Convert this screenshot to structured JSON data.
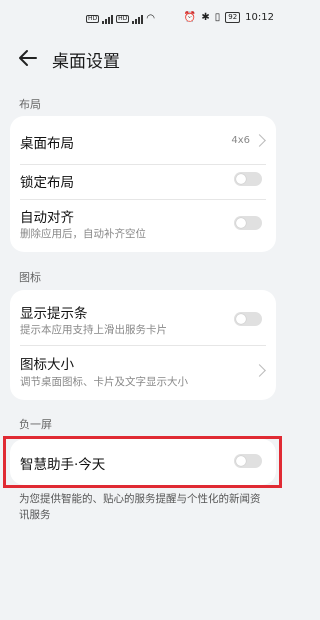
{
  "status": {
    "network_badges": [
      "HD",
      "HD"
    ],
    "battery": "92",
    "time": "10:12",
    "icons": [
      "signal-icon",
      "wifi-icon",
      "alarm-icon",
      "bluetooth-icon",
      "vibrate-icon",
      "battery-icon"
    ]
  },
  "header": {
    "title": "桌面设置",
    "back_icon": "back-arrow-icon"
  },
  "sections": {
    "layout": {
      "label": "布局",
      "items": [
        {
          "title": "桌面布局",
          "value": "4x6"
        },
        {
          "title": "锁定布局",
          "toggle_on": false
        },
        {
          "title": "自动对齐",
          "subtitle": "删除应用后，自动补齐空位",
          "toggle_on": false
        }
      ]
    },
    "icons": {
      "label": "图标",
      "items": [
        {
          "title": "显示提示条",
          "subtitle": "提示本应用支持上滑出服务卡片",
          "toggle_on": false
        },
        {
          "title": "图标大小",
          "subtitle": "调节桌面图标、卡片及文字显示大小"
        }
      ]
    },
    "minus_one": {
      "label": "负一屏",
      "items": [
        {
          "title": "智慧助手·今天",
          "toggle_on": false
        }
      ],
      "footnote": "为您提供智能的、贴心的服务提醒与个性化的新闻资讯服务"
    }
  },
  "colors": {
    "highlight": "#e02a33",
    "background": "#f1f3f5",
    "toggle_off": "#e0e0e0"
  }
}
